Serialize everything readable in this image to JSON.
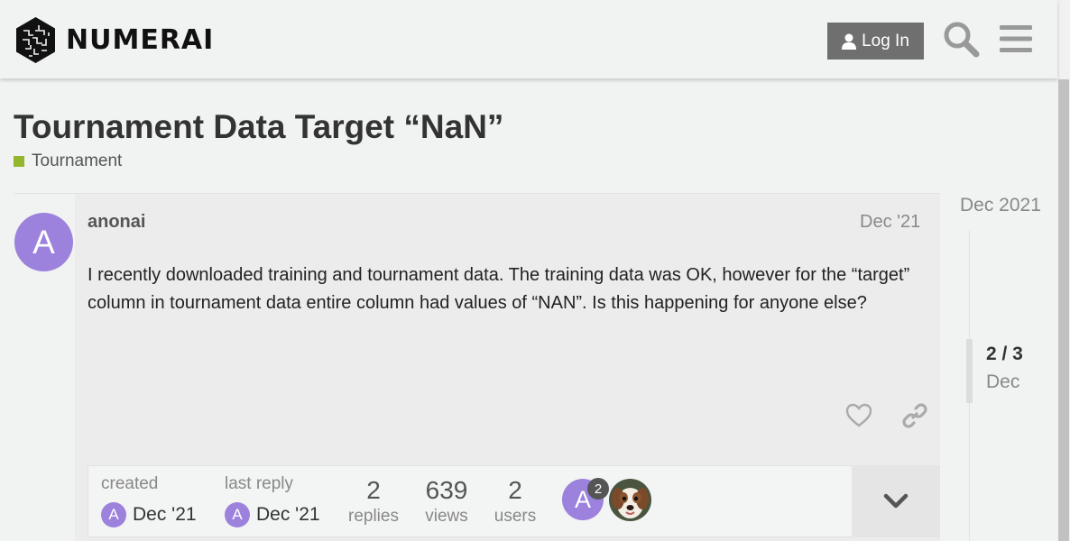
{
  "header": {
    "logo_text": "NUMERAI",
    "login_label": "Log In",
    "icons": [
      "numerai-logo-icon",
      "user-icon",
      "search-icon",
      "hamburger-menu-icon"
    ]
  },
  "topic": {
    "title": "Tournament Data Target “NaN”",
    "category": "Tournament",
    "category_color": "#92b72d"
  },
  "post": {
    "avatar_letter": "A",
    "avatar_color": "#9c82dd",
    "username": "anonai",
    "date": "Dec '21",
    "text": "I recently downloaded training and tournament data. The training data was OK, however for the “target” column in tournament data entire column had values of “NAN”. Is this happening for anyone else?",
    "icons": [
      "heart-icon",
      "link-icon"
    ]
  },
  "meta": {
    "created_label": "created",
    "created_date": "Dec '21",
    "created_avatar_letter": "A",
    "last_reply_label": "last reply",
    "last_reply_date": "Dec '21",
    "last_reply_avatar_letter": "A",
    "replies_count": "2",
    "replies_label": "replies",
    "views_count": "639",
    "views_label": "views",
    "users_count": "2",
    "users_label": "users",
    "participant_letter": "A",
    "participant_badge": "2"
  },
  "timeline": {
    "top_date": "Dec 2021",
    "position": "2 / 3",
    "current_date": "Dec"
  }
}
